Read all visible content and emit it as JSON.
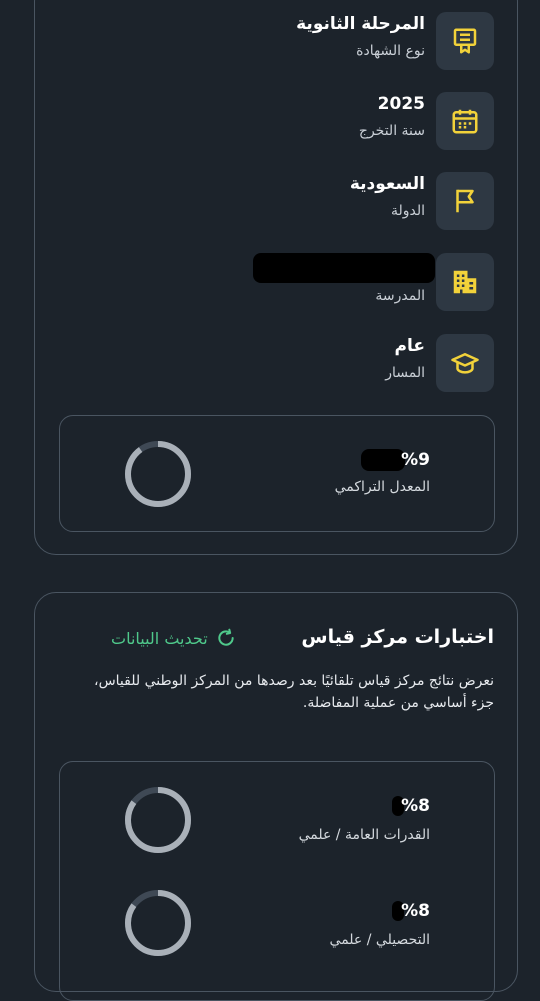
{
  "profile": {
    "certificate": {
      "value": "المرحلة الثانوية",
      "label": "نوع الشهادة",
      "icon": "certificate-icon"
    },
    "graduation": {
      "value": "2025",
      "label": "سنة التخرج",
      "icon": "calendar-icon"
    },
    "country": {
      "value": "السعودية",
      "label": "الدولة",
      "icon": "flag-icon"
    },
    "school": {
      "value": "",
      "label": "المدرسة",
      "icon": "building-icon"
    },
    "track": {
      "value": "عام",
      "label": "المسار",
      "icon": "graduation-cap-icon"
    },
    "gpa": {
      "value": "%9",
      "label": "المعدل التراكمي",
      "progress": 0.9
    }
  },
  "qiyas": {
    "title": "اختبارات مركز قياس",
    "refresh_label": "تحديث البيانات",
    "description": "نعرض نتائج مركز قياس تلقائيًا بعد رصدها من المركز الوطني للقياس، جزء أساسي من عملية المفاضلة.",
    "tests": [
      {
        "value": "%8",
        "label": "القدرات العامة / علمي",
        "progress": 0.85
      },
      {
        "value": "%8",
        "label": "التحصيلي / علمي",
        "progress": 0.85
      }
    ]
  },
  "colors": {
    "background": "#1c232b",
    "accent": "#f2d23a",
    "success": "#4fc98b",
    "ring": "#a9b0b8",
    "ring_track": "#3f4955"
  }
}
